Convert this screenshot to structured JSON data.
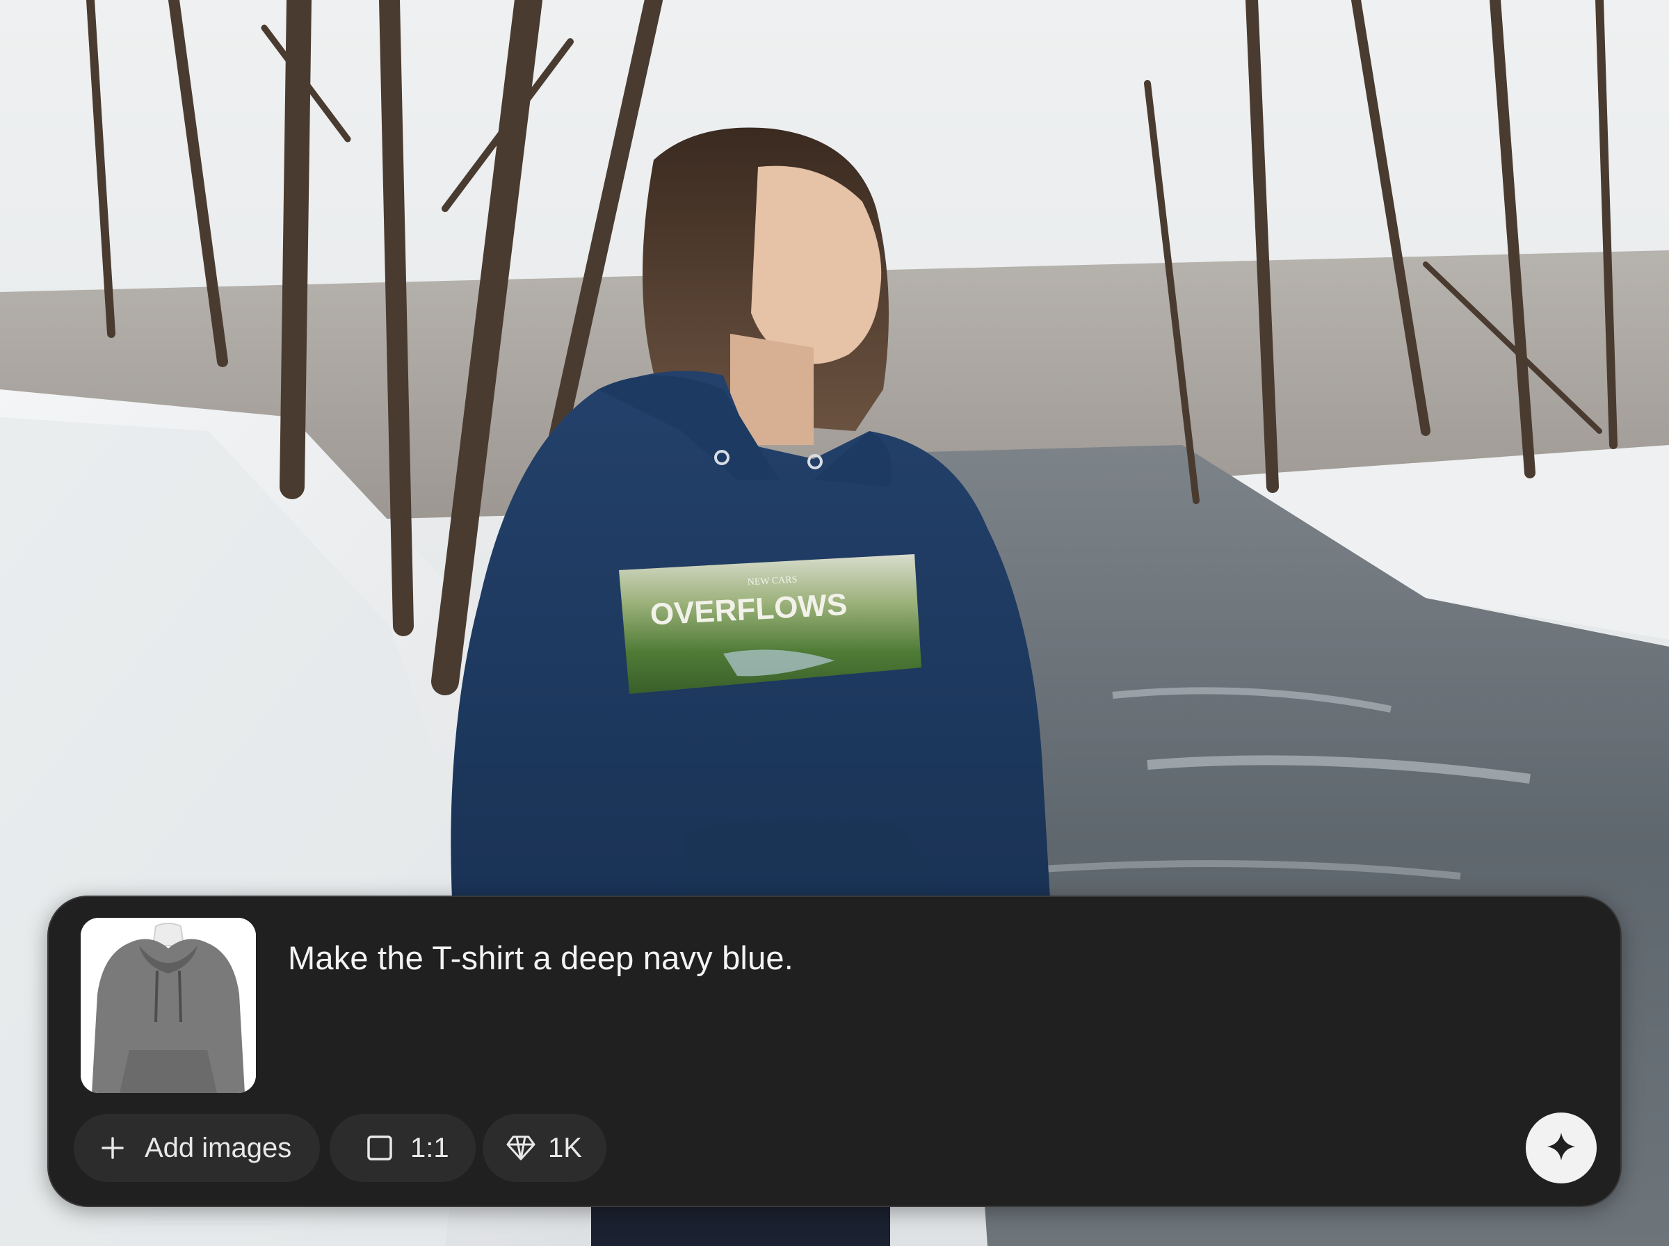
{
  "composer": {
    "prompt": "Make the T-shirt a deep navy blue.",
    "thumbnail_icon": "hoodie-reference-image",
    "add_images_label": "Add images",
    "aspect_ratio_label": "1:1",
    "resolution_label": "1K",
    "icons": {
      "add": "plus-icon",
      "aspect_ratio": "square-icon",
      "resolution": "diamond-icon",
      "send": "sparkle-icon"
    }
  },
  "photo": {
    "print_text": "OVERFLOWS",
    "print_small_text": "NEW CARS"
  },
  "colors": {
    "panel_bg": "#202020",
    "chip_bg": "#2c2c2c",
    "hoodie_navy": "#1f3d66",
    "send_button_bg": "#f2f2f2"
  }
}
